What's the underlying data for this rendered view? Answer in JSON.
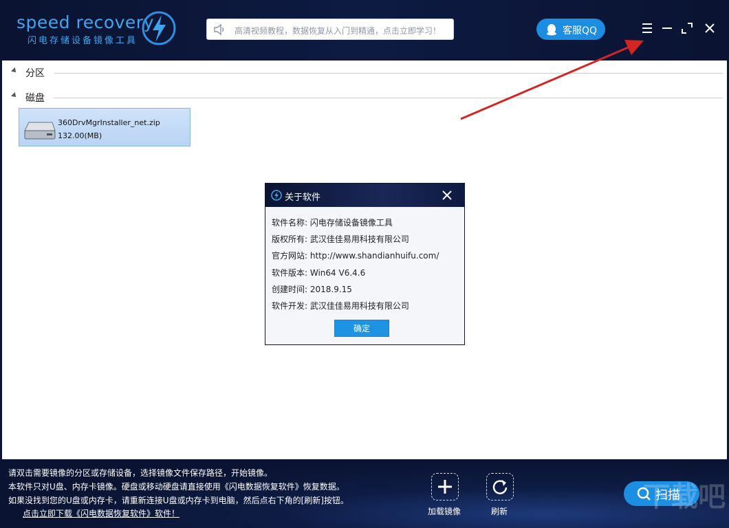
{
  "header": {
    "logo_title": "speed recovery",
    "logo_subtitle": "闪电存储设备镜像工具",
    "notice_text": "高清视频教程，数据恢复从入门到精通，点击立即学习！",
    "qq_label": "客服QQ"
  },
  "sections": [
    {
      "label": "分区"
    },
    {
      "label": "磁盘"
    }
  ],
  "disk": {
    "name": "360DrvMgrInstaller_net.zip",
    "size": "132.00(MB)"
  },
  "dialog": {
    "title": "关于软件",
    "rows": [
      "软件名称: 闪电存储设备镜像工具",
      "版权所有: 武汉佳佳易用科技有限公司",
      "官方网站: http://www.shandianhuifu.com/",
      "软件版本: Win64 V6.4.6",
      "创建时间: 2018.9.15",
      "软件开发: 武汉佳佳易用科技有限公司"
    ],
    "ok_label": "确定"
  },
  "footer": {
    "lines": [
      "请双击需要镜像的分区或存储设备，选择镜像文件保存路径，开始镜像。",
      "本软件只对U盘、内存卡镜像。硬盘或移动硬盘请直接使用《闪电数据恢复软件》恢复数据。",
      "如果没找到您的U盘或内存卡，请重新连接U盘或内存卡到电脑，然后点右下角的[刷新]按钮。"
    ],
    "link": "点击立即下载《闪电数据恢复软件》软件！",
    "load_label": "加载镜像",
    "refresh_label": "刷新",
    "scan_label": "扫描"
  },
  "watermark": "下载吧",
  "colors": {
    "accent": "#1d8fe3",
    "header_bg": "#0a1331",
    "annotation": "#d42424"
  }
}
